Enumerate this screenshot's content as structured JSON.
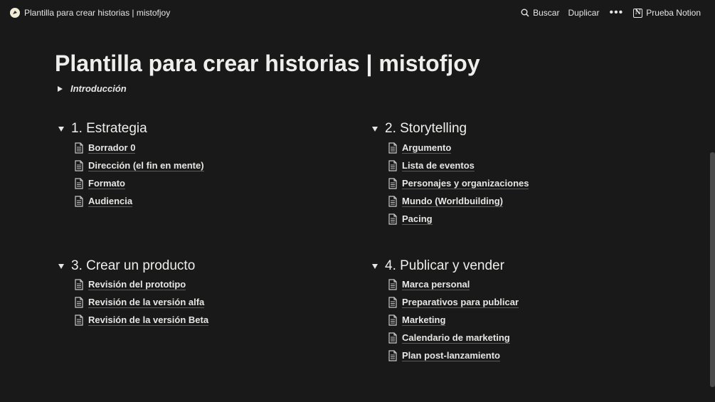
{
  "topbar": {
    "page_title": "Plantilla para crear historias | mistofjoy",
    "search_label": "Buscar",
    "duplicate_label": "Duplicar",
    "more_label": "•••",
    "notion_label": "Prueba Notion"
  },
  "page": {
    "title": "Plantilla para crear historias | mistofjoy",
    "intro_toggle": "Introducción"
  },
  "sections": [
    {
      "heading": "1. Estrategia",
      "items": [
        "Borrador 0",
        "Dirección (el fin en mente)",
        "Formato",
        "Audiencia"
      ]
    },
    {
      "heading": "2. Storytelling",
      "items": [
        "Argumento",
        "Lista de eventos",
        "Personajes y organizaciones",
        "Mundo (Worldbuilding)",
        "Pacing"
      ]
    },
    {
      "heading": "3. Crear un producto",
      "items": [
        "Revisión del prototipo",
        "Revisión de la versión alfa",
        "Revisión de la versión Beta"
      ]
    },
    {
      "heading": "4. Publicar y vender",
      "items": [
        "Marca personal",
        "Preparativos para publicar",
        "Marketing",
        "Calendario de marketing",
        "Plan post-lanzamiento"
      ]
    }
  ]
}
